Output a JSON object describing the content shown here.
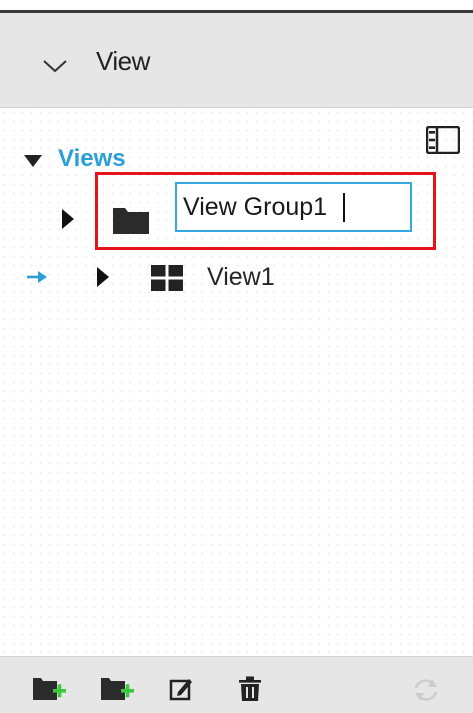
{
  "header": {
    "title": "View",
    "collapse_icon": "chevron-down-icon"
  },
  "toolbar": {
    "layout_icon": "list-layout-icon"
  },
  "tree": {
    "root": {
      "label": "Views",
      "expanded": true
    },
    "editing_group": {
      "icon": "folder-icon",
      "name_value": "View Group1",
      "expanded": false
    },
    "view_item": {
      "icon": "grid-view-icon",
      "label": "View1",
      "expanded": false
    }
  },
  "footer": {
    "buttons": [
      {
        "name": "add-view-group-icon",
        "enabled": true
      },
      {
        "name": "add-view-icon",
        "enabled": true
      },
      {
        "name": "edit-icon",
        "enabled": true
      },
      {
        "name": "delete-icon",
        "enabled": true
      },
      {
        "name": "refresh-icon",
        "enabled": false
      }
    ]
  },
  "colors": {
    "accent": "#2a9fd8",
    "annotation_red": "#e5141a",
    "input_border": "#35a8e0",
    "add_green": "#3cc83c",
    "disabled": "#cccccc"
  }
}
